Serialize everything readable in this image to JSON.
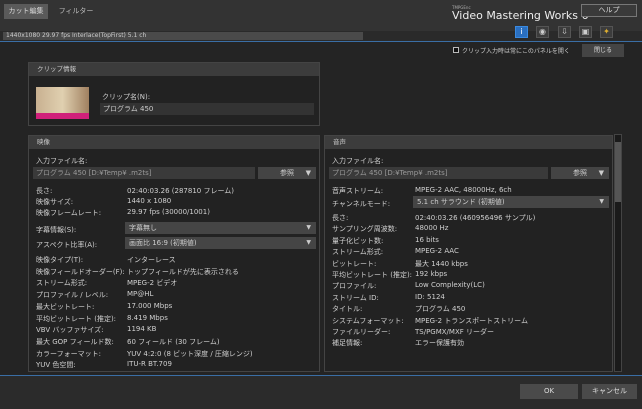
{
  "tabs": {
    "cut": "カット編集",
    "filter": "フィルター"
  },
  "app": {
    "vendor": "TMPGEnc",
    "title": "Video Mastering Works 6",
    "help": "ヘルプ"
  },
  "infobar": {
    "text": "1440x1080 29.97 fps Interlace(TopFirst)  5.1 ch"
  },
  "icons": [
    "info-icon",
    "disc-icon",
    "import-icon",
    "export-icon",
    "wizard-icon"
  ],
  "options": {
    "always_open_label": "クリップ入力時は常にこのパネルを開く",
    "always_open_checked": false,
    "close": "閉じる"
  },
  "clip": {
    "header": "クリップ情報",
    "name_label": "クリップ名(N):",
    "name_value": "プログラム 450"
  },
  "video": {
    "header": "映像",
    "file_label": "入力ファイル名:",
    "file_value": "プログラム 450 [D:¥Temp¥                    .m2ts]",
    "browse": "参照",
    "rows": [
      {
        "label": "長さ:",
        "value": "02:40:03.26 (287810 フレーム)"
      },
      {
        "label": "映像サイズ:",
        "value": "1440 x 1080"
      },
      {
        "label": "映像フレームレート:",
        "value": "29.97 fps (30000/1001)"
      }
    ],
    "subtitle_label": "字幕情報(S):",
    "subtitle_value": "字幕無し",
    "aspect_label": "アスペクト比率(A):",
    "aspect_value": "画面比 16:9 (初期値)",
    "rows2": [
      {
        "label": "映像タイプ(T):",
        "value": "インターレース"
      },
      {
        "label": "映像フィールドオーダー(F):",
        "value": "トップフィールドが先に表示される"
      },
      {
        "label": "ストリーム形式:",
        "value": "MPEG-2 ビデオ"
      },
      {
        "label": "プロファイル / レベル:",
        "value": "MP@HL"
      },
      {
        "label": "最大ビットレート:",
        "value": "17.000 Mbps"
      },
      {
        "label": "平均ビットレート (推定):",
        "value": "8.419 Mbps"
      },
      {
        "label": "VBV バッファサイズ:",
        "value": "1194 KB"
      },
      {
        "label": "最大 GOP フィールド数:",
        "value": "60 フィールド (30 フレーム)"
      },
      {
        "label": "カラーフォーマット:",
        "value": "YUV 4:2:0 (8 ビット深度 / 圧縮レンジ)"
      },
      {
        "label": "YUV 色空間:",
        "value": "ITU-R BT.709"
      }
    ]
  },
  "audio": {
    "header": "音声",
    "file_label": "入力ファイル名:",
    "file_value": "プログラム 450 [D:¥Temp¥                    .m2ts]",
    "browse": "参照",
    "stream_label": "音声ストリーム:",
    "stream_value": "MPEG-2 AAC, 48000Hz, 6ch",
    "channel_label": "チャンネルモード:",
    "channel_value": "5.1 ch サラウンド (初期値)",
    "rows": [
      {
        "label": "長さ:",
        "value": "02:40:03.26 (460956496 サンプル)"
      },
      {
        "label": "サンプリング周波数:",
        "value": "48000 Hz"
      },
      {
        "label": "量子化ビット数:",
        "value": "16 bits"
      },
      {
        "label": "ストリーム形式:",
        "value": "MPEG-2 AAC"
      },
      {
        "label": "ビットレート:",
        "value": "最大 1440 kbps"
      },
      {
        "label": "平均ビットレート (推定):",
        "value": "192 kbps"
      },
      {
        "label": "プロファイル:",
        "value": "Low Complexity(LC)"
      },
      {
        "label": "ストリーム ID:",
        "value": "ID: 5124"
      },
      {
        "label": "タイトル:",
        "value": "プログラム 450"
      },
      {
        "label": "システムフォーマット:",
        "value": "MPEG-2 トランスポートストリーム"
      },
      {
        "label": "ファイルリーダー:",
        "value": "TS/PGMX/MXF リーダー"
      },
      {
        "label": "補足情報:",
        "value": "エラー保護有効"
      }
    ]
  },
  "footer": {
    "ok": "OK",
    "cancel": "キャンセル"
  }
}
